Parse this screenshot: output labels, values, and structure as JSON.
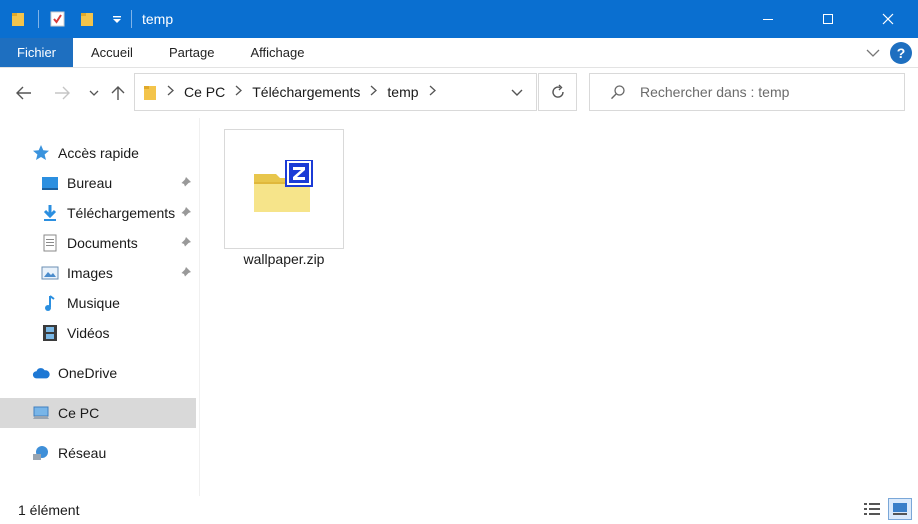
{
  "window": {
    "title": "temp",
    "accent_color": "#0a6fd0",
    "controls": {
      "minimize": "—",
      "maximize": "☐",
      "close": "✕"
    }
  },
  "ribbon": {
    "tabs": [
      {
        "label": "Fichier"
      },
      {
        "label": "Accueil"
      },
      {
        "label": "Partage"
      },
      {
        "label": "Affichage"
      }
    ],
    "help_label": "?"
  },
  "address": {
    "crumbs": [
      "Ce PC",
      "Téléchargements",
      "temp"
    ]
  },
  "search": {
    "placeholder": "Rechercher dans : temp"
  },
  "navpane": {
    "quick_access": "Accès rapide",
    "items": [
      {
        "label": "Bureau",
        "icon": "desktop-icon",
        "pinned": true
      },
      {
        "label": "Téléchargements",
        "icon": "downloads-icon",
        "pinned": true
      },
      {
        "label": "Documents",
        "icon": "documents-icon",
        "pinned": true
      },
      {
        "label": "Images",
        "icon": "pictures-icon",
        "pinned": true
      },
      {
        "label": "Musique",
        "icon": "music-icon",
        "pinned": false
      },
      {
        "label": "Vidéos",
        "icon": "videos-icon",
        "pinned": false
      }
    ],
    "onedrive": "OneDrive",
    "this_pc": "Ce PC",
    "network": "Réseau"
  },
  "content": {
    "files": [
      {
        "name": "wallpaper.zip",
        "icon": "zip-folder-icon"
      }
    ]
  },
  "status": {
    "item_count": "1 élément"
  }
}
